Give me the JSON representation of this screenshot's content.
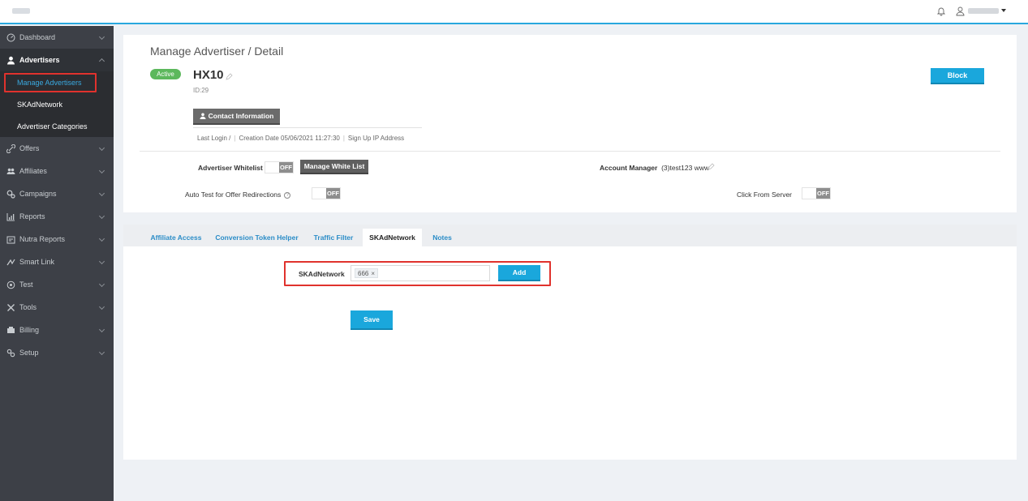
{
  "topbar": {
    "logo": "logo",
    "bell_icon": "bell-icon",
    "user_icon": "user-icon"
  },
  "sidebar": {
    "items": [
      {
        "label": "Dashboard",
        "icon": "dashboard-icon"
      },
      {
        "label": "Advertisers",
        "icon": "user-icon",
        "expanded": true,
        "children": [
          {
            "label": "Manage Advertisers"
          },
          {
            "label": "SKAdNetwork"
          },
          {
            "label": "Advertiser Categories"
          }
        ]
      },
      {
        "label": "Offers",
        "icon": "link-icon"
      },
      {
        "label": "Affiliates",
        "icon": "users-icon"
      },
      {
        "label": "Campaigns",
        "icon": "campaigns-icon"
      },
      {
        "label": "Reports",
        "icon": "chart-icon"
      },
      {
        "label": "Nutra Reports",
        "icon": "report-icon"
      },
      {
        "label": "Smart Link",
        "icon": "smart-link-icon"
      },
      {
        "label": "Test",
        "icon": "test-icon"
      },
      {
        "label": "Tools",
        "icon": "tools-icon"
      },
      {
        "label": "Billing",
        "icon": "billing-icon"
      },
      {
        "label": "Setup",
        "icon": "setup-icon"
      }
    ]
  },
  "header": {
    "title": "Manage Advertiser / Detail",
    "status": "Active",
    "advertiser_name": "HX10",
    "advertiser_id": "ID:29",
    "block_label": "Block",
    "contact_label": "Contact Information",
    "meta": {
      "last_login": "Last Login  /",
      "creation_date": "Creation Date  05/06/2021 11:27:30",
      "signup_ip": "Sign Up IP Address"
    },
    "whitelist_label": "Advertiser Whitelist",
    "whitelist_state": "OFF",
    "manage_whitelist_label": "Manage White List",
    "account_manager_label": "Account Manager",
    "account_manager_value": "(3)test123 www",
    "auto_test_label": "Auto Test for Offer Redirections",
    "auto_test_state": "OFF",
    "click_server_label": "Click From Server",
    "click_server_state": "OFF"
  },
  "tabs": [
    {
      "label": "Affiliate Access"
    },
    {
      "label": "Conversion Token Helper"
    },
    {
      "label": "Traffic Filter"
    },
    {
      "label": "SKAdNetwork",
      "active": true
    },
    {
      "label": "Notes"
    }
  ],
  "skadnetwork_form": {
    "label": "SKAdNetwork",
    "tag_value": "666",
    "tag_remove": "×",
    "add_label": "Add",
    "save_label": "Save"
  },
  "colors": {
    "accent": "#1aa7dc",
    "sidebar_bg": "#3d4047",
    "active_badge": "#5cb85c",
    "highlight_border": "#e0322d"
  }
}
